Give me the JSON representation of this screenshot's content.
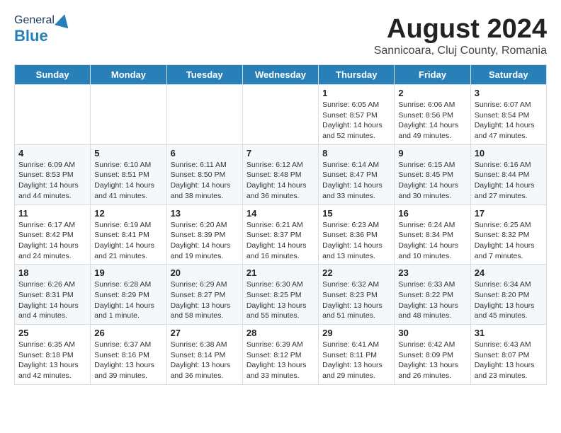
{
  "header": {
    "logo_general": "General",
    "logo_blue": "Blue",
    "main_title": "August 2024",
    "subtitle": "Sannicoara, Cluj County, Romania"
  },
  "days": [
    "Sunday",
    "Monday",
    "Tuesday",
    "Wednesday",
    "Thursday",
    "Friday",
    "Saturday"
  ],
  "weeks": [
    [
      {
        "date": "",
        "text": ""
      },
      {
        "date": "",
        "text": ""
      },
      {
        "date": "",
        "text": ""
      },
      {
        "date": "",
        "text": ""
      },
      {
        "date": "1",
        "text": "Sunrise: 6:05 AM\nSunset: 8:57 PM\nDaylight: 14 hours and 52 minutes."
      },
      {
        "date": "2",
        "text": "Sunrise: 6:06 AM\nSunset: 8:56 PM\nDaylight: 14 hours and 49 minutes."
      },
      {
        "date": "3",
        "text": "Sunrise: 6:07 AM\nSunset: 8:54 PM\nDaylight: 14 hours and 47 minutes."
      }
    ],
    [
      {
        "date": "4",
        "text": "Sunrise: 6:09 AM\nSunset: 8:53 PM\nDaylight: 14 hours and 44 minutes."
      },
      {
        "date": "5",
        "text": "Sunrise: 6:10 AM\nSunset: 8:51 PM\nDaylight: 14 hours and 41 minutes."
      },
      {
        "date": "6",
        "text": "Sunrise: 6:11 AM\nSunset: 8:50 PM\nDaylight: 14 hours and 38 minutes."
      },
      {
        "date": "7",
        "text": "Sunrise: 6:12 AM\nSunset: 8:48 PM\nDaylight: 14 hours and 36 minutes."
      },
      {
        "date": "8",
        "text": "Sunrise: 6:14 AM\nSunset: 8:47 PM\nDaylight: 14 hours and 33 minutes."
      },
      {
        "date": "9",
        "text": "Sunrise: 6:15 AM\nSunset: 8:45 PM\nDaylight: 14 hours and 30 minutes."
      },
      {
        "date": "10",
        "text": "Sunrise: 6:16 AM\nSunset: 8:44 PM\nDaylight: 14 hours and 27 minutes."
      }
    ],
    [
      {
        "date": "11",
        "text": "Sunrise: 6:17 AM\nSunset: 8:42 PM\nDaylight: 14 hours and 24 minutes."
      },
      {
        "date": "12",
        "text": "Sunrise: 6:19 AM\nSunset: 8:41 PM\nDaylight: 14 hours and 21 minutes."
      },
      {
        "date": "13",
        "text": "Sunrise: 6:20 AM\nSunset: 8:39 PM\nDaylight: 14 hours and 19 minutes."
      },
      {
        "date": "14",
        "text": "Sunrise: 6:21 AM\nSunset: 8:37 PM\nDaylight: 14 hours and 16 minutes."
      },
      {
        "date": "15",
        "text": "Sunrise: 6:23 AM\nSunset: 8:36 PM\nDaylight: 14 hours and 13 minutes."
      },
      {
        "date": "16",
        "text": "Sunrise: 6:24 AM\nSunset: 8:34 PM\nDaylight: 14 hours and 10 minutes."
      },
      {
        "date": "17",
        "text": "Sunrise: 6:25 AM\nSunset: 8:32 PM\nDaylight: 14 hours and 7 minutes."
      }
    ],
    [
      {
        "date": "18",
        "text": "Sunrise: 6:26 AM\nSunset: 8:31 PM\nDaylight: 14 hours and 4 minutes."
      },
      {
        "date": "19",
        "text": "Sunrise: 6:28 AM\nSunset: 8:29 PM\nDaylight: 14 hours and 1 minute."
      },
      {
        "date": "20",
        "text": "Sunrise: 6:29 AM\nSunset: 8:27 PM\nDaylight: 13 hours and 58 minutes."
      },
      {
        "date": "21",
        "text": "Sunrise: 6:30 AM\nSunset: 8:25 PM\nDaylight: 13 hours and 55 minutes."
      },
      {
        "date": "22",
        "text": "Sunrise: 6:32 AM\nSunset: 8:23 PM\nDaylight: 13 hours and 51 minutes."
      },
      {
        "date": "23",
        "text": "Sunrise: 6:33 AM\nSunset: 8:22 PM\nDaylight: 13 hours and 48 minutes."
      },
      {
        "date": "24",
        "text": "Sunrise: 6:34 AM\nSunset: 8:20 PM\nDaylight: 13 hours and 45 minutes."
      }
    ],
    [
      {
        "date": "25",
        "text": "Sunrise: 6:35 AM\nSunset: 8:18 PM\nDaylight: 13 hours and 42 minutes."
      },
      {
        "date": "26",
        "text": "Sunrise: 6:37 AM\nSunset: 8:16 PM\nDaylight: 13 hours and 39 minutes."
      },
      {
        "date": "27",
        "text": "Sunrise: 6:38 AM\nSunset: 8:14 PM\nDaylight: 13 hours and 36 minutes."
      },
      {
        "date": "28",
        "text": "Sunrise: 6:39 AM\nSunset: 8:12 PM\nDaylight: 13 hours and 33 minutes."
      },
      {
        "date": "29",
        "text": "Sunrise: 6:41 AM\nSunset: 8:11 PM\nDaylight: 13 hours and 29 minutes."
      },
      {
        "date": "30",
        "text": "Sunrise: 6:42 AM\nSunset: 8:09 PM\nDaylight: 13 hours and 26 minutes."
      },
      {
        "date": "31",
        "text": "Sunrise: 6:43 AM\nSunset: 8:07 PM\nDaylight: 13 hours and 23 minutes."
      }
    ]
  ]
}
